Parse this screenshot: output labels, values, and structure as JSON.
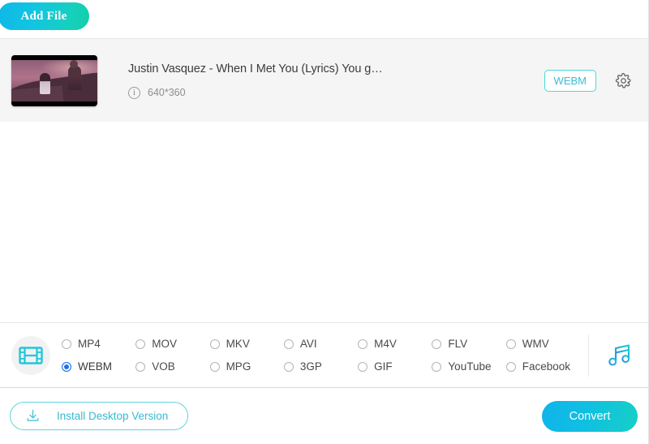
{
  "toolbar": {
    "add_file_label": "Add File"
  },
  "file": {
    "title": "Justin Vasquez - When I Met You (Lyrics) You g…",
    "resolution": "640*360",
    "info_icon": "info-icon",
    "format_badge": "WEBM",
    "settings_icon": "gear-icon",
    "thumbnail_alt": "video-thumbnail"
  },
  "format_panel": {
    "video_tab_icon": "film-strip-icon",
    "audio_tab_icon": "music-note-icon",
    "selected": "WEBM",
    "options": [
      {
        "label": "MP4",
        "selected": false
      },
      {
        "label": "MOV",
        "selected": false
      },
      {
        "label": "MKV",
        "selected": false
      },
      {
        "label": "AVI",
        "selected": false
      },
      {
        "label": "M4V",
        "selected": false
      },
      {
        "label": "FLV",
        "selected": false
      },
      {
        "label": "WMV",
        "selected": false
      },
      {
        "label": "WEBM",
        "selected": true
      },
      {
        "label": "VOB",
        "selected": false
      },
      {
        "label": "MPG",
        "selected": false
      },
      {
        "label": "3GP",
        "selected": false
      },
      {
        "label": "GIF",
        "selected": false
      },
      {
        "label": "YouTube",
        "selected": false
      },
      {
        "label": "Facebook",
        "selected": false
      }
    ]
  },
  "bottom_bar": {
    "install_label": "Install Desktop Version",
    "install_icon": "download-icon",
    "convert_label": "Convert"
  },
  "colors": {
    "accent_cyan": "#19c5d8",
    "gradient_start": "#0fb4ea",
    "gradient_end": "#16cfc6",
    "radio_selected": "#1a73e8",
    "row_bg": "#f5f5f5"
  }
}
